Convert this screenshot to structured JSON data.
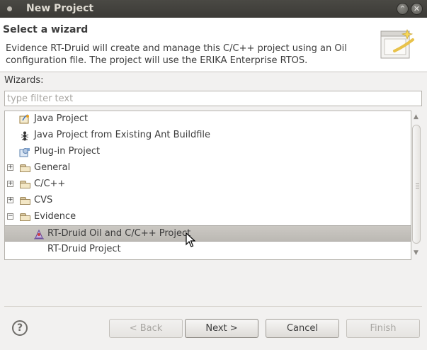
{
  "window": {
    "title": "New Project"
  },
  "header": {
    "title": "Select a wizard",
    "description": "Evidence RT-Druid will create and manage this C/C++ project using an Oil configuration file. The project will use the ERIKA Enterprise RTOS."
  },
  "wizards_label": "Wizards:",
  "filter": {
    "placeholder": "type filter text",
    "value": ""
  },
  "tree": {
    "items": [
      {
        "label": "Java Project",
        "icon": "java-project-icon"
      },
      {
        "label": "Java Project from Existing Ant Buildfile",
        "icon": "ant-icon"
      },
      {
        "label": "Plug-in Project",
        "icon": "plugin-project-icon"
      },
      {
        "label": "General",
        "icon": "folder-icon",
        "expander": "+"
      },
      {
        "label": "C/C++",
        "icon": "folder-icon",
        "expander": "+"
      },
      {
        "label": "CVS",
        "icon": "folder-icon",
        "expander": "+"
      },
      {
        "label": "Evidence",
        "icon": "folder-open-icon",
        "expander": "−"
      },
      {
        "label": "RT-Druid Oil and C/C++ Project",
        "icon": "rt-druid-icon",
        "selected": true
      },
      {
        "label": "RT-Druid Project",
        "icon": ""
      }
    ]
  },
  "buttons": {
    "help": "?",
    "back": "< Back",
    "next": "Next >",
    "cancel": "Cancel",
    "finish": "Finish"
  },
  "colors": {
    "selection": "#c4c1bc",
    "titlebar": "#3c3b37"
  }
}
